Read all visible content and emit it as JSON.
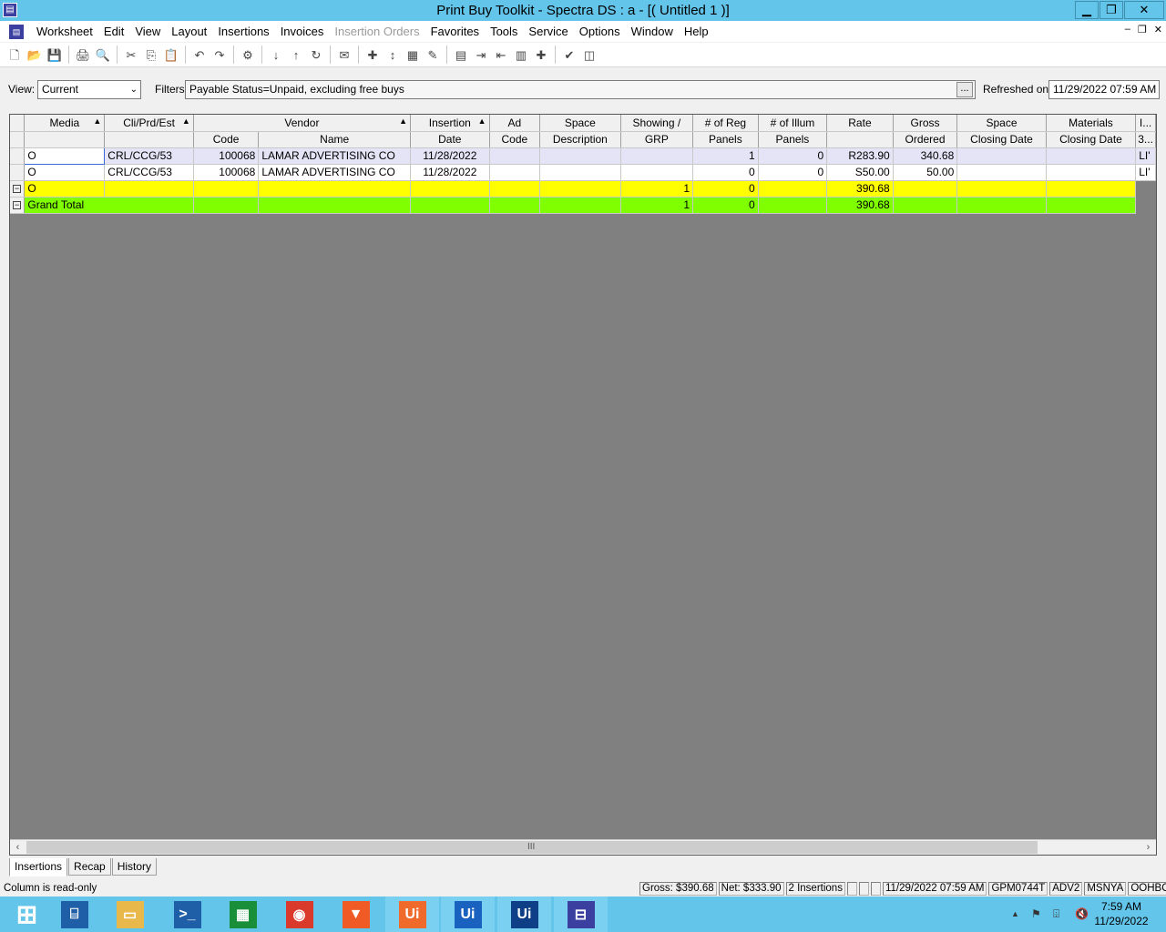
{
  "window": {
    "title": "Print Buy Toolkit - Spectra DS : a - [( Untitled 1 )]",
    "minimize": "▁",
    "restore": "❐",
    "close": "✕"
  },
  "menu": {
    "items": [
      "Worksheet",
      "Edit",
      "View",
      "Layout",
      "Insertions",
      "Invoices",
      "Insertion Orders",
      "Favorites",
      "Tools",
      "Service",
      "Options",
      "Window",
      "Help"
    ],
    "disabled_index": 6,
    "mdi_min": "–",
    "mdi_restore": "❐",
    "mdi_close": "✕"
  },
  "toolbar": {
    "icons": [
      "new-icon",
      "open-icon",
      "save-icon",
      "print-icon",
      "print-preview-icon",
      "cut-icon",
      "copy-icon",
      "paste-icon",
      "undo-icon",
      "redo-icon",
      "settings-icon",
      "move-down-icon",
      "move-up-icon",
      "refresh-icon",
      "email-icon",
      "add-row-icon",
      "insert-row-icon",
      "grid-icon",
      "edit-icon",
      "report-icon",
      "export-icon",
      "import-icon",
      "document-icon",
      "plus-icon",
      "check-icon",
      "layout-icon"
    ],
    "glyphs": [
      "🗋",
      "📂",
      "💾",
      "🖨",
      "🔍",
      "✂",
      "⎘",
      "📋",
      "↶",
      "↷",
      "⚙",
      "↓",
      "↑",
      "↻",
      "✉",
      "✚",
      "↕",
      "▦",
      "✎",
      "▤",
      "⇥",
      "⇤",
      "▥",
      "✚",
      "✔",
      "◫"
    ],
    "separators_after": [
      2,
      4,
      7,
      9,
      10,
      13,
      14,
      18,
      23
    ]
  },
  "filterbar": {
    "view_label": "View:",
    "view_value": "Current",
    "filters_label": "Filters:",
    "filters_value": "Payable Status=Unpaid, excluding free buys",
    "filters_button": "...",
    "refreshed_label": "Refreshed on:",
    "refreshed_value": "11/29/2022 07:59 AM"
  },
  "grid": {
    "header_top": [
      "Media",
      "Cli/Prd/Est",
      "Vendor",
      "Insertion",
      "Ad",
      "Space",
      "Showing /",
      "# of Reg",
      "# of Illum",
      "Rate",
      "Gross",
      "Space",
      "Materials",
      "I..."
    ],
    "header_bottom": [
      "",
      "",
      "Code",
      "Name",
      "Date",
      "Code",
      "Description",
      "GRP",
      "Panels",
      "Panels",
      "",
      "Ordered",
      "Closing Date",
      "Closing Date",
      "3..."
    ],
    "rows": [
      {
        "media": "O",
        "cpe": "CRL/CCG/53",
        "vcode": "100068",
        "vname": "LAMAR ADVERTISING CO",
        "date": "11/28/2022",
        "adcode": "",
        "spacedesc": "",
        "grp": "",
        "reg": "1",
        "illum": "0",
        "rate": "R283.90",
        "gross": "340.68",
        "spaceclose": "",
        "matclose": "",
        "last": "LI'"
      },
      {
        "media": "O",
        "cpe": "CRL/CCG/53",
        "vcode": "100068",
        "vname": "LAMAR ADVERTISING CO",
        "date": "11/28/2022",
        "adcode": "",
        "spacedesc": "",
        "grp": "",
        "reg": "0",
        "illum": "0",
        "rate": "S50.00",
        "gross": "50.00",
        "spaceclose": "",
        "matclose": "",
        "last": "LI'"
      }
    ],
    "subtotal": {
      "label": "O",
      "reg": "1",
      "illum": "0",
      "gross": "390.68"
    },
    "grand_total": {
      "label": "Grand Total",
      "reg": "1",
      "illum": "0",
      "gross": "390.68"
    },
    "collapse_glyph": "−"
  },
  "scrollbar": {
    "left": "‹",
    "right": "›",
    "grip": "III"
  },
  "tabs": [
    "Insertions",
    "Recap",
    "History"
  ],
  "status": {
    "message": "Column is read-only",
    "gross": "Gross: $390.68",
    "net": "Net: $333.90",
    "insertions": "2 Insertions",
    "datetime": "11/29/2022  07:59 AM",
    "user": "GPM0744T",
    "agency": "ADV2",
    "office": "MSNYA",
    "code": "OOHBOT"
  },
  "taskbar": {
    "apps": [
      {
        "name": "start-icon",
        "label": "⊞",
        "color": "#ffffff"
      },
      {
        "name": "server-manager-icon",
        "label": "⌸",
        "color": "#1f5fa8"
      },
      {
        "name": "file-explorer-icon",
        "label": "▭",
        "color": "#e8b84a"
      },
      {
        "name": "powershell-icon",
        "label": ">_",
        "color": "#1f5fa8"
      },
      {
        "name": "store-icon",
        "label": "▦",
        "color": "#1a8f3a"
      },
      {
        "name": "chrome-icon",
        "label": "◉",
        "color": "#d93a2b"
      },
      {
        "name": "brave-icon",
        "label": "▼",
        "color": "#f05a24"
      },
      {
        "name": "uipath-studio-icon",
        "label": "Ui",
        "color": "#f06a2c"
      },
      {
        "name": "uipath-assistant-icon",
        "label": "Ui",
        "color": "#1a62c0"
      },
      {
        "name": "uipath-robot-icon",
        "label": "Ui",
        "color": "#0e3f86"
      },
      {
        "name": "print-buy-toolkit-icon",
        "label": "⊟",
        "color": "#3b3fa0"
      }
    ],
    "tray_up": "▲",
    "tray_flag": "⚑",
    "tray_network": "⌹",
    "tray_volume": "🔇",
    "time": "7:59 AM",
    "date": "11/29/2022"
  },
  "colors": {
    "titlebar": "#63c5ea",
    "subtotal_row": "#ffff00",
    "grand_total_row": "#80ff00",
    "selected_row": "#e4e4f6",
    "grid_background": "#808080"
  }
}
